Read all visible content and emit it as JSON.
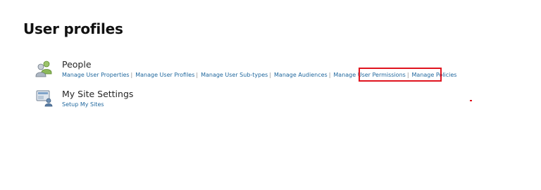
{
  "page": {
    "title": "User profiles"
  },
  "sections": {
    "people": {
      "icon": "people-icon",
      "heading": "People",
      "links": [
        "Manage User Properties",
        "Manage User Profiles",
        "Manage User Sub-types",
        "Manage Audiences",
        "Manage User Permissions",
        "Manage Policies"
      ],
      "separator": "|"
    },
    "mysite": {
      "icon": "my-site-settings-icon",
      "heading": "My Site Settings",
      "links": [
        "Setup My Sites"
      ]
    }
  },
  "colors": {
    "link": "#21689e",
    "highlight": "#e0141e",
    "heading": "#262626"
  }
}
